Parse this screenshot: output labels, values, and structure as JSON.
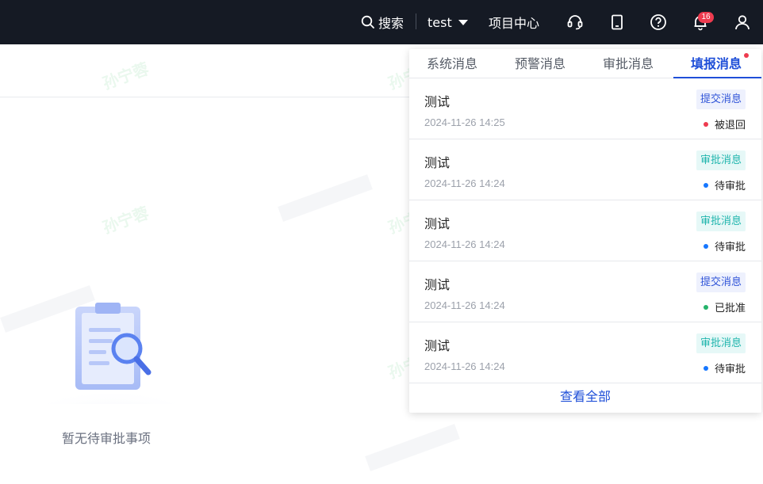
{
  "topbar": {
    "search_label": "搜索",
    "user_name": "test",
    "project_center": "项目中心",
    "notification_count": "16"
  },
  "empty_state": {
    "text": "暂无待审批事项"
  },
  "watermark": "孙宁蓉",
  "panel": {
    "tabs": [
      {
        "label": "系统消息"
      },
      {
        "label": "预警消息"
      },
      {
        "label": "审批消息"
      },
      {
        "label": "填报消息"
      }
    ],
    "active_tab": 3,
    "messages": [
      {
        "title": "测试",
        "time": "2024-11-26 14:25",
        "tag": "提交消息",
        "status": "被退回",
        "status_color": "#ee3b4f"
      },
      {
        "title": "测试",
        "time": "2024-11-26 14:24",
        "tag": "审批消息",
        "status": "待审批",
        "status_color": "#1677ff"
      },
      {
        "title": "测试",
        "time": "2024-11-26 14:24",
        "tag": "审批消息",
        "status": "待审批",
        "status_color": "#1677ff"
      },
      {
        "title": "测试",
        "time": "2024-11-26 14:24",
        "tag": "提交消息",
        "status": "已批准",
        "status_color": "#25b36b"
      },
      {
        "title": "测试",
        "time": "2024-11-26 14:24",
        "tag": "审批消息",
        "status": "待审批",
        "status_color": "#1677ff"
      }
    ],
    "view_all": "查看全部"
  },
  "colors": {
    "topbar_bg": "#151a24",
    "accent": "#1f4fd8",
    "badge": "#ee3b4f"
  }
}
